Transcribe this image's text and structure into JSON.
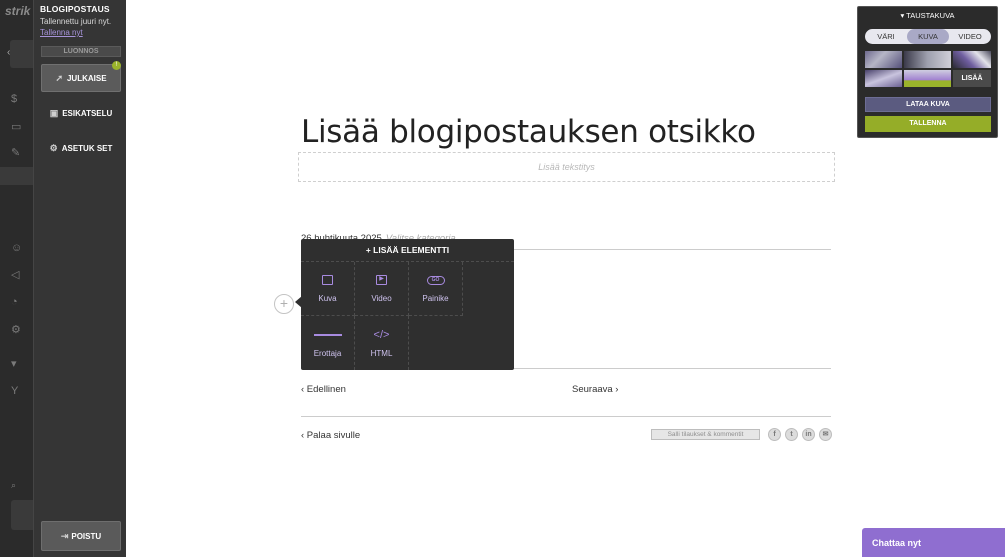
{
  "colors": {
    "accent": "#a88be0",
    "save_green": "#95ad28",
    "chat_purple": "#8f6ed0",
    "sidebar_bg": "#353535"
  },
  "bg_nav": {
    "logo": "strik"
  },
  "sidebar": {
    "title": "BLOGIPOSTAUS",
    "saved_text": "Tallennettu juuri nyt.",
    "save_now": "Tallenna nyt",
    "draft": "LUONNOS",
    "publish": "JULKAISE",
    "publish_badge": "!",
    "preview": "ESIKATSELU",
    "settings": "ASETUK SET",
    "exit": "POISTU",
    "icons": {
      "publish": "rocket-icon",
      "preview": "preview-icon",
      "settings": "gear-icon",
      "exit": "exit-icon"
    }
  },
  "post": {
    "title": "Lisää blogipostauksen otsikko",
    "subtitle_placeholder": "Lisää tekstitys",
    "date": "26 huhtikuuta 2025",
    "category_placeholder": "Valitse kategoria",
    "add_button": "+"
  },
  "element_popup": {
    "title": "+ LISÄÄ ELEMENTTI",
    "items": [
      {
        "label": "Kuva",
        "icon": "image-icon"
      },
      {
        "label": "Video",
        "icon": "video-icon"
      },
      {
        "label": "Painike",
        "icon": "button-icon",
        "icon_text": "GO"
      },
      {
        "label": "Erottaja",
        "icon": "divider-icon"
      },
      {
        "label": "HTML",
        "icon": "code-icon",
        "icon_text": "</>"
      }
    ]
  },
  "navigation": {
    "previous": "‹ Edellinen",
    "next": "Seuraava ›",
    "back": "‹ Palaa sivulle",
    "share": "Salli tilaukset & kommentit",
    "social_icons": [
      "facebook-icon",
      "twitter-icon",
      "linkedin-icon",
      "email-icon"
    ]
  },
  "background_panel": {
    "title": "▾ TAUSTAKUVA",
    "tabs": [
      "VÄRI",
      "KUVA",
      "VIDEO"
    ],
    "active_tab": "KUVA",
    "add": "LISÄÄ",
    "upload": "LATAA KUVA",
    "save": "TALLENNA"
  },
  "chat": {
    "label": "Chattaa nyt"
  }
}
